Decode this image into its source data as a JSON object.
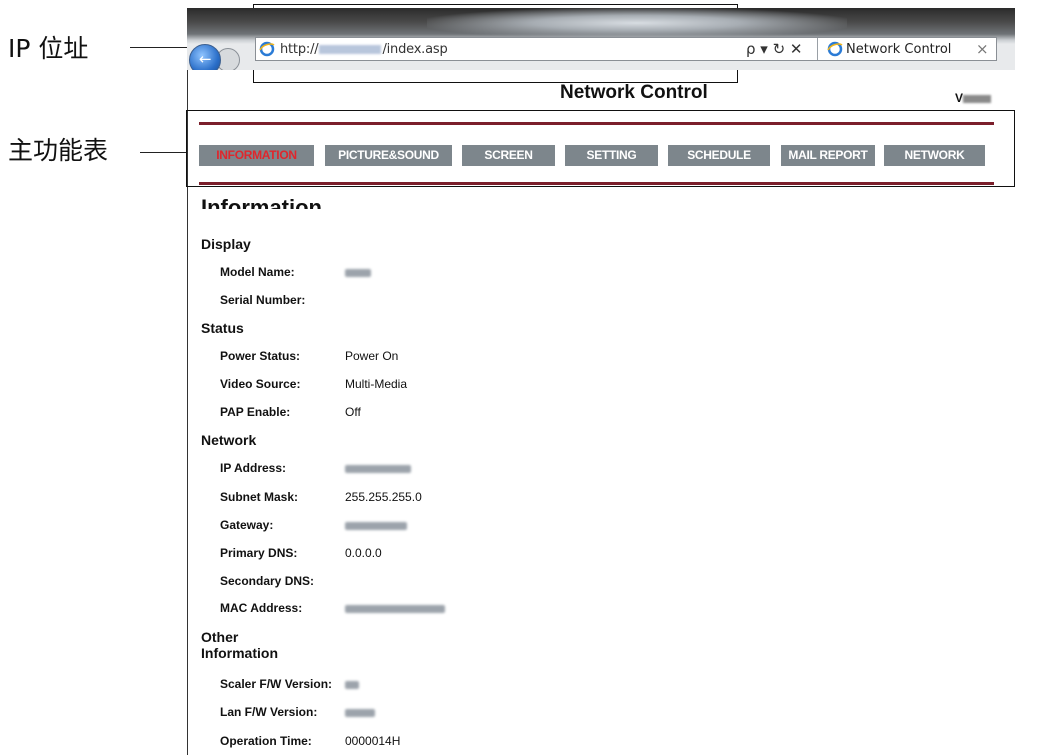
{
  "annotations": {
    "ip_label": "IP 位址",
    "menu_label": "主功能表"
  },
  "browser": {
    "address_prefix": "http://",
    "address_suffix": "/index.asp",
    "address_tools": "ρ ▾ ↻ ✕",
    "tab_title": "Network Control",
    "tab_close": "×"
  },
  "page": {
    "title": "Network Control",
    "version_prefix": "V"
  },
  "menu": {
    "items": [
      {
        "label": "INFORMATION",
        "active": true
      },
      {
        "label": "PICTURE&SOUND",
        "active": false
      },
      {
        "label": "SCREEN",
        "active": false
      },
      {
        "label": "SETTING",
        "active": false
      },
      {
        "label": "SCHEDULE",
        "active": false
      },
      {
        "label": "MAIL REPORT",
        "active": false
      },
      {
        "label": "NETWORK",
        "active": false
      }
    ]
  },
  "info": {
    "heading": "Information",
    "display": {
      "heading": "Display",
      "model_name_label": "Model Name:",
      "serial_number_label": "Serial Number:"
    },
    "status": {
      "heading": "Status",
      "power_status_label": "Power Status:",
      "power_status_value": "Power On",
      "video_source_label": "Video Source:",
      "video_source_value": "Multi-Media",
      "pap_enable_label": "PAP Enable:",
      "pap_enable_value": "Off"
    },
    "network": {
      "heading": "Network",
      "ip_address_label": "IP Address:",
      "subnet_mask_label": "Subnet Mask:",
      "subnet_mask_value": "255.255.255.0",
      "gateway_label": "Gateway:",
      "primary_dns_label": "Primary DNS:",
      "primary_dns_value": "0.0.0.0",
      "secondary_dns_label": "Secondary DNS:",
      "mac_address_label": "MAC Address:"
    },
    "other": {
      "heading_line1": "Other",
      "heading_line2": "Information",
      "scaler_fw_label": "Scaler F/W Version:",
      "lan_fw_label": "Lan F/W Version:",
      "operation_time_label": "Operation Time:",
      "operation_time_value": "0000014H"
    }
  },
  "colors": {
    "menu_button": "#7d868c",
    "menu_active_text": "#e0262c",
    "menu_rule": "#7b1f2b"
  }
}
